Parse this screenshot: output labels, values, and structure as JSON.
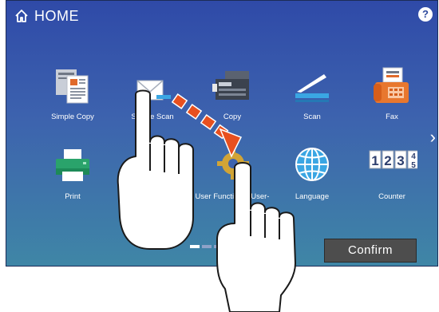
{
  "header": {
    "title": "HOME",
    "help_label": "?"
  },
  "tiles": [
    {
      "label": "Simple Copy",
      "icon": "simple-copy-icon"
    },
    {
      "label": "Simple Scan",
      "icon": "simple-scan-icon"
    },
    {
      "label": "Copy",
      "icon": "copy-icon"
    },
    {
      "label": "Scan",
      "icon": "scan-icon"
    },
    {
      "label": "Fax",
      "icon": "fax-icon"
    },
    {
      "label": "Print",
      "icon": "print-icon"
    },
    {
      "label": "User Functions -User-",
      "icon": "user-functions-icon"
    },
    {
      "label": "Language",
      "icon": "language-icon"
    },
    {
      "label": "Counter",
      "icon": "counter-icon"
    }
  ],
  "counter_digits": [
    "1",
    "2",
    "3",
    "4",
    "5"
  ],
  "nav": {
    "next_arrow": "›"
  },
  "confirm_label": "Confirm",
  "colors": {
    "accent": "#3d63ae",
    "button": "#4d4d4d",
    "arrow": "#e8501f"
  }
}
